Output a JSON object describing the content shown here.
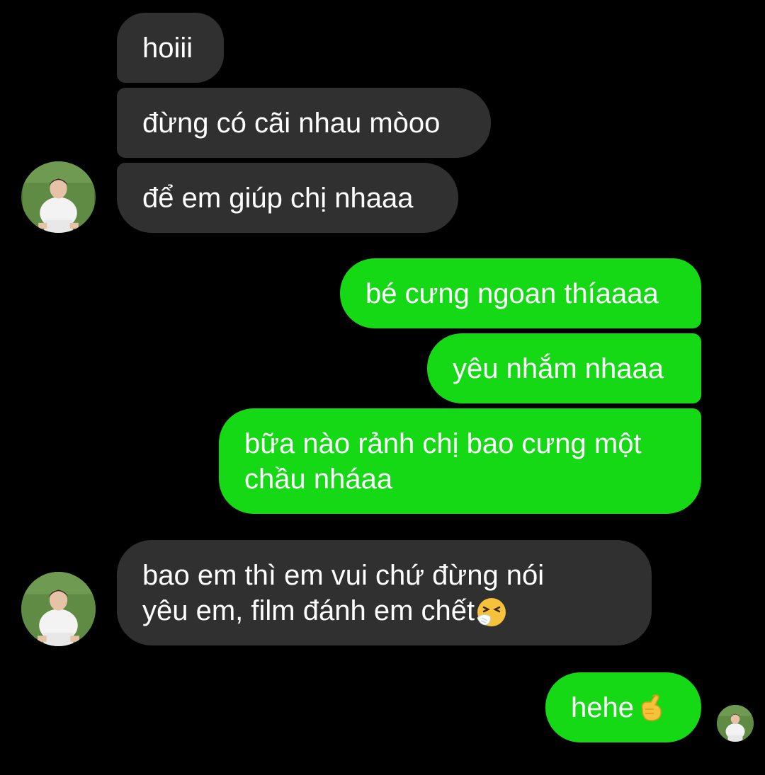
{
  "messages": [
    {
      "side": "incoming",
      "text": "hoiii"
    },
    {
      "side": "incoming",
      "text": "đừng có cãi nhau mòoo"
    },
    {
      "side": "incoming",
      "text": "để em giúp chị nhaaa"
    },
    {
      "side": "outgoing",
      "text": "bé cưng ngoan thíaaaa"
    },
    {
      "side": "outgoing",
      "text": "yêu nhắm nhaaa"
    },
    {
      "side": "outgoing",
      "lines": [
        "bữa nào rảnh chị bao cưng một",
        "chầu nháaa"
      ]
    },
    {
      "side": "incoming",
      "lines": [
        "bao em thì em vui chứ đừng nói",
        "yêu em, film đánh em chết"
      ],
      "emoji": "sneezing-face-emoji"
    },
    {
      "side": "outgoing",
      "text": "hehe",
      "emoji": "crossed-fingers-heart-emoji"
    }
  ],
  "colors": {
    "background": "#000000",
    "incoming_bubble": "#303030",
    "outgoing_bubble": "#16d916",
    "text": "#ffffff"
  }
}
